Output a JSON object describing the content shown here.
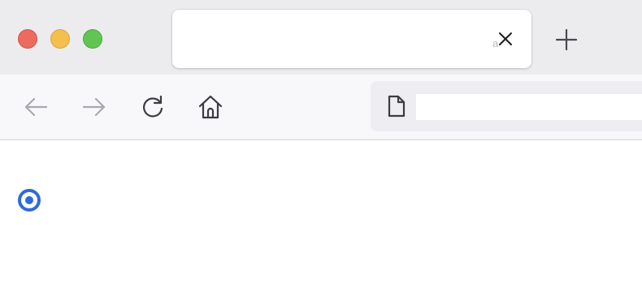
{
  "window": {
    "controls": {
      "close": {
        "color": "#ec6a5e"
      },
      "minimize": {
        "color": "#f4bf4f"
      },
      "maximize": {
        "color": "#61c554"
      }
    }
  },
  "tab": {
    "title": "",
    "faded_char": "a",
    "close_icon": "close-icon"
  },
  "new_tab": {
    "icon": "plus-icon"
  },
  "toolbar": {
    "back": {
      "icon": "arrow-left-icon",
      "enabled": false
    },
    "forward": {
      "icon": "arrow-right-icon",
      "enabled": false
    },
    "reload": {
      "icon": "reload-icon"
    },
    "home": {
      "icon": "home-icon"
    }
  },
  "address_bar": {
    "icon": "page-icon",
    "value": "",
    "placeholder": ""
  },
  "content": {
    "radio": {
      "checked": true,
      "accent": "#2f6bd8"
    }
  }
}
